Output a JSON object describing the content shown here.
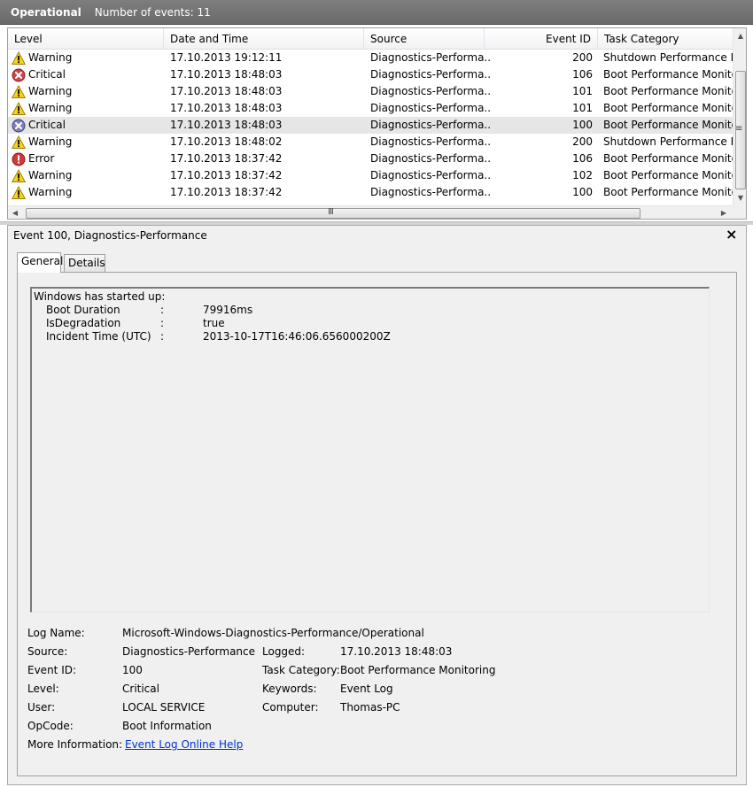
{
  "titlebar": {
    "log_name": "Operational",
    "event_count": "Number of events: 11"
  },
  "grid": {
    "columns": [
      "Level",
      "Date and Time",
      "Source",
      "Event ID",
      "Task Category"
    ],
    "rows": [
      {
        "icon": "warning-icon",
        "level": "Warning",
        "date": "17.10.2013 19:12:11",
        "source": "Diagnostics-Performa...",
        "event_id": "200",
        "task": "Shutdown Performance Mo"
      },
      {
        "icon": "critical-icon",
        "level": "Critical",
        "date": "17.10.2013 18:48:03",
        "source": "Diagnostics-Performa...",
        "event_id": "106",
        "task": "Boot Performance Monitor"
      },
      {
        "icon": "warning-icon",
        "level": "Warning",
        "date": "17.10.2013 18:48:03",
        "source": "Diagnostics-Performa...",
        "event_id": "101",
        "task": "Boot Performance Monitor"
      },
      {
        "icon": "warning-icon",
        "level": "Warning",
        "date": "17.10.2013 18:48:03",
        "source": "Diagnostics-Performa...",
        "event_id": "101",
        "task": "Boot Performance Monitor"
      },
      {
        "icon": "critical-icon",
        "level": "Critical",
        "date": "17.10.2013 18:48:03",
        "source": "Diagnostics-Performa...",
        "event_id": "100",
        "task": "Boot Performance Monitor",
        "selected": true
      },
      {
        "icon": "warning-icon",
        "level": "Warning",
        "date": "17.10.2013 18:48:02",
        "source": "Diagnostics-Performa...",
        "event_id": "200",
        "task": "Shutdown Performance Mo"
      },
      {
        "icon": "error-icon",
        "level": "Error",
        "date": "17.10.2013 18:37:42",
        "source": "Diagnostics-Performa...",
        "event_id": "106",
        "task": "Boot Performance Monitor"
      },
      {
        "icon": "warning-icon",
        "level": "Warning",
        "date": "17.10.2013 18:37:42",
        "source": "Diagnostics-Performa...",
        "event_id": "102",
        "task": "Boot Performance Monitor"
      },
      {
        "icon": "warning-icon",
        "level": "Warning",
        "date": "17.10.2013 18:37:42",
        "source": "Diagnostics-Performa...",
        "event_id": "100",
        "task": "Boot Performance Monitor"
      }
    ],
    "scroll_grip": "≡",
    "hscroll_grip": "III",
    "scroll_up": "▲",
    "scroll_down": "▼",
    "scroll_left": "◀",
    "scroll_right": "▶"
  },
  "detail": {
    "title": "Event 100, Diagnostics-Performance",
    "close": "×",
    "tabs": [
      "General",
      "Details"
    ],
    "description": {
      "intro": "Windows has started up:",
      "pairs": [
        {
          "key": "Boot Duration",
          "sep": ":",
          "value": "79916ms"
        },
        {
          "key": "IsDegradation",
          "sep": ":",
          "value": "true"
        },
        {
          "key": "Incident Time (UTC)",
          "sep": ":",
          "value": "2013-10-17T16:46:06.656000200Z"
        }
      ]
    },
    "props": {
      "log_name_label": "Log Name:",
      "log_name": "Microsoft-Windows-Diagnostics-Performance/Operational",
      "source_label": "Source:",
      "source": "Diagnostics-Performance",
      "logged_label": "Logged:",
      "logged": "17.10.2013 18:48:03",
      "event_id_label": "Event ID:",
      "event_id": "100",
      "task_label": "Task Category:",
      "task": "Boot Performance Monitoring",
      "level_label": "Level:",
      "level": "Critical",
      "keywords_label": "Keywords:",
      "keywords": "Event Log",
      "user_label": "User:",
      "user": "LOCAL SERVICE",
      "computer_label": "Computer:",
      "computer": "Thomas-PC",
      "opcode_label": "OpCode:",
      "opcode": "Boot Information",
      "more_info_label": "More Information:",
      "more_info_link": "Event Log Online Help"
    }
  }
}
